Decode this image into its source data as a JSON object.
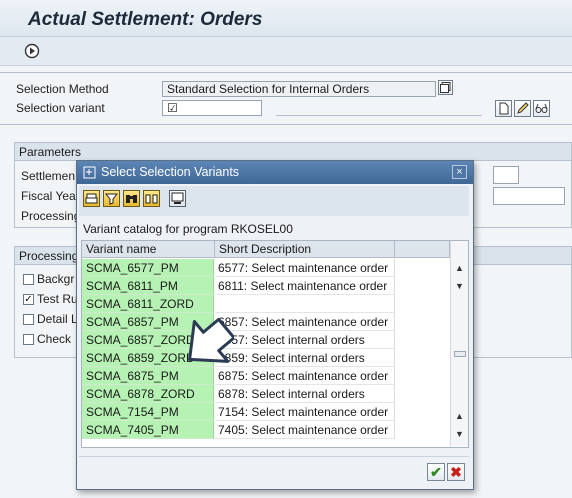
{
  "title": "Actual Settlement: Orders",
  "toolbar": {
    "execute_icon": "execute-icon"
  },
  "form": {
    "selection_method_label": "Selection Method",
    "selection_method_value": "Standard Selection for Internal Orders",
    "selection_variant_label": "Selection variant",
    "selection_variant_value": "☑"
  },
  "parameters": {
    "header": "Parameters",
    "settlement_label": "Settlemen",
    "fiscal_year_label": "Fiscal Yea",
    "processing_label": "Processing"
  },
  "processing_options": {
    "header": "Processing",
    "background_label": "Backgr",
    "test_run_label": "Test Ru",
    "detail_list_label": "Detail L",
    "check_label": "Check"
  },
  "dialog": {
    "title": "Select Selection Variants",
    "close": "×",
    "catalog_text": "Variant catalog for program RKOSEL00",
    "columns": [
      "Variant name",
      "Short Description"
    ],
    "rows": [
      {
        "name": "SCMA_6577_PM",
        "desc": "6577: Select maintenance order"
      },
      {
        "name": "SCMA_6811_PM",
        "desc": "6811: Select maintenance order"
      },
      {
        "name": "SCMA_6811_ZORD",
        "desc": ""
      },
      {
        "name": "SCMA_6857_PM",
        "desc": "6857: Select maintenance order"
      },
      {
        "name": "SCMA_6857_ZORD",
        "desc": "6857: Select internal orders"
      },
      {
        "name": "SCMA_6859_ZORD",
        "desc": "6859: Select internal orders"
      },
      {
        "name": "SCMA_6875_PM",
        "desc": "6875: Select maintenance order"
      },
      {
        "name": "SCMA_6878_ZORD",
        "desc": "6878: Select internal orders"
      },
      {
        "name": "SCMA_7154_PM",
        "desc": "7154: Select maintenance order"
      },
      {
        "name": "SCMA_7405_PM",
        "desc": "7405: Select maintenance order"
      }
    ],
    "ok_symbol": "✔",
    "cancel_symbol": "✖"
  },
  "colors": {
    "variant_cell": "#b6f2b3",
    "title_bar": "#4a73a5"
  }
}
